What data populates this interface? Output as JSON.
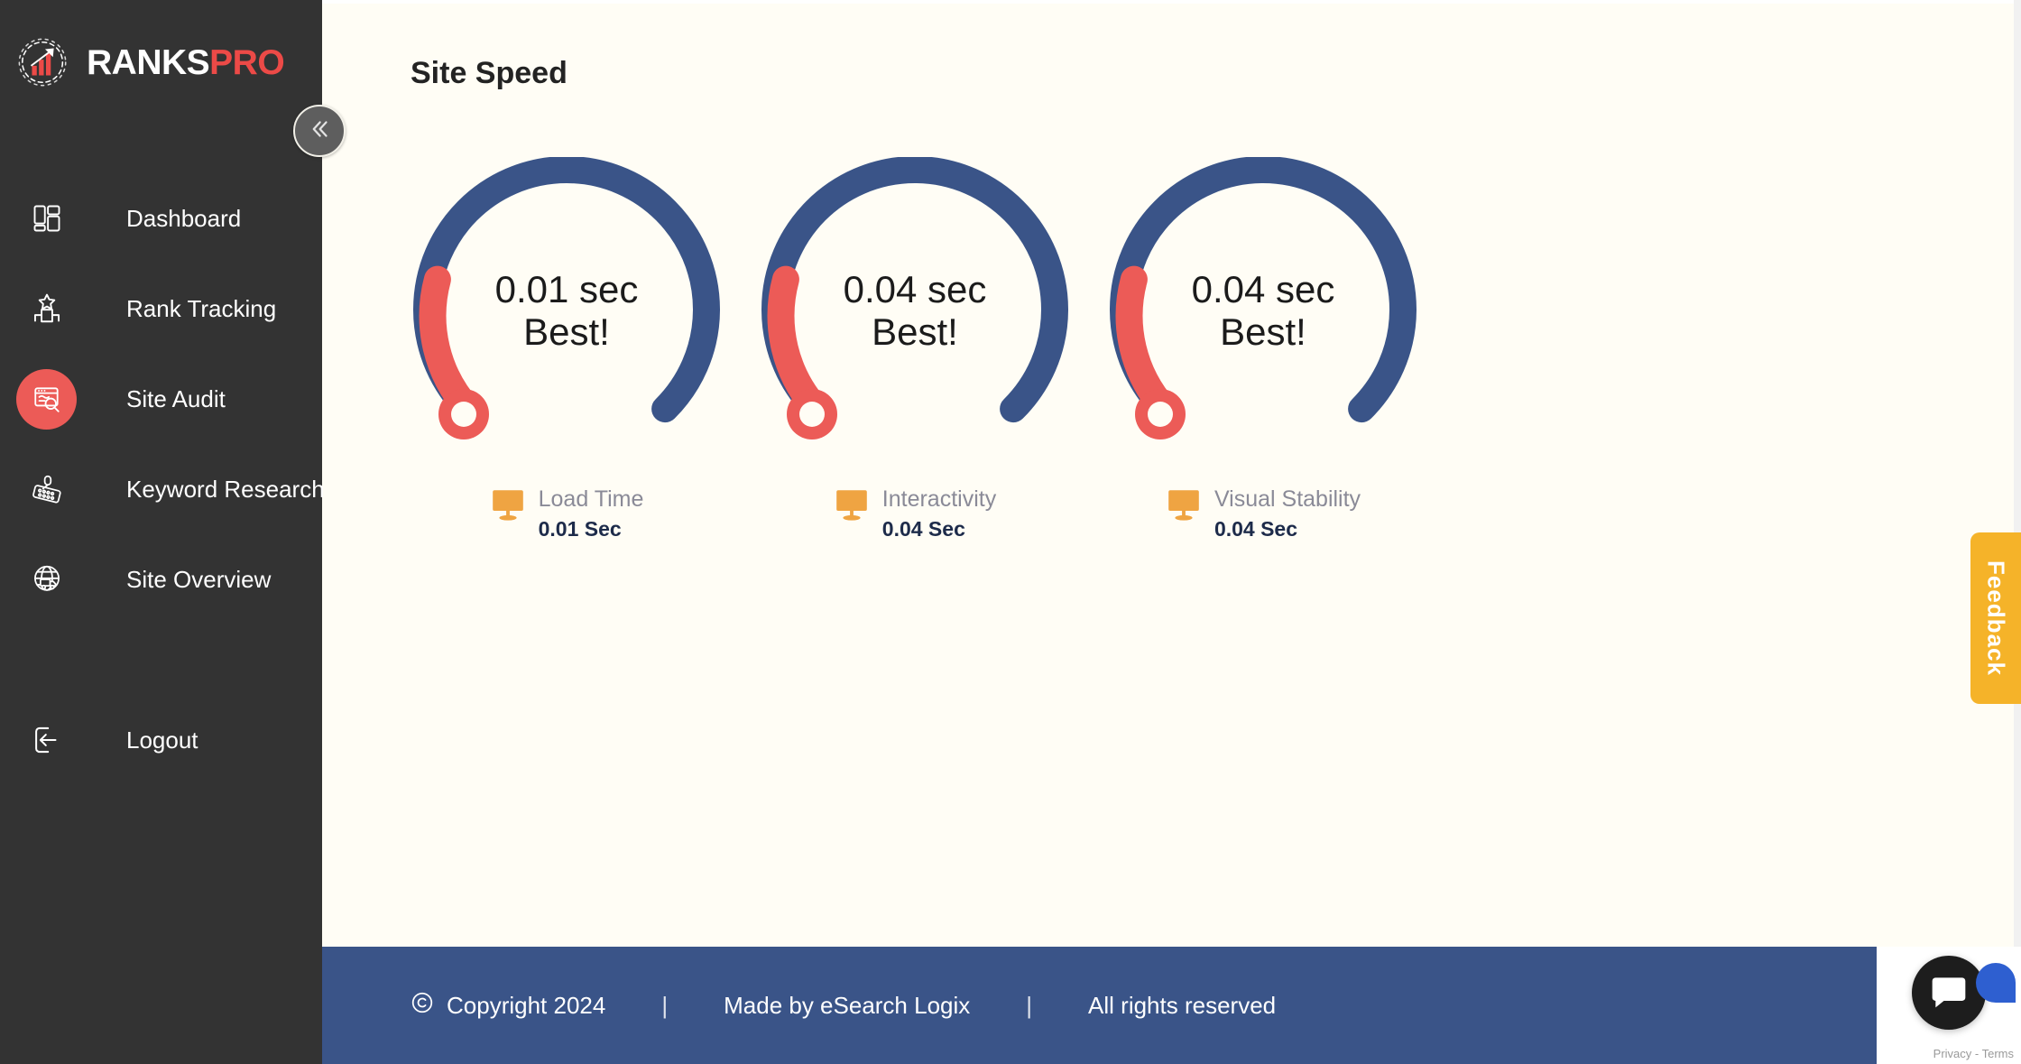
{
  "brand": {
    "name_primary": "RANKS",
    "name_secondary": "PRO",
    "logo_icon": "gear-bar-chart-arrow-icon"
  },
  "sidebar": {
    "collapse_icon": "chevron-double-left-icon",
    "items": [
      {
        "label": "Dashboard",
        "icon": "dashboard-grid-icon",
        "active": false
      },
      {
        "label": "Rank Tracking",
        "icon": "podium-star-icon",
        "active": false
      },
      {
        "label": "Site Audit",
        "icon": "browser-search-icon",
        "active": true
      },
      {
        "label": "Keyword Research",
        "icon": "keyboard-mouse-icon",
        "active": false
      },
      {
        "label": "Site Overview",
        "icon": "globe-truck-icon",
        "active": false
      },
      {
        "label": "Logout",
        "icon": "logout-arrow-icon",
        "active": false
      }
    ],
    "active_bg_color": "#ec5b57",
    "bg_color": "#333333"
  },
  "main": {
    "page_title": "Site Speed",
    "bg_color": "#fffdf5"
  },
  "chart_data": {
    "type": "gauge",
    "title": "Site Speed",
    "gauge_track_color": "#3a5488",
    "gauge_progress_color": "#ec5b57",
    "gauge_knob_color": "#ec5b57",
    "gauge_max_sweep_degrees": 270,
    "unit": "sec",
    "gauges": [
      {
        "metric": "Load Time",
        "value": 0.01,
        "value_text": "0.01 sec",
        "status_text": "Best!",
        "metric_value_text": "0.01 Sec",
        "metric_icon": "monitor-icon",
        "progress_fraction": 0.33
      },
      {
        "metric": "Interactivity",
        "value": 0.04,
        "value_text": "0.04 sec",
        "status_text": "Best!",
        "metric_value_text": "0.04 Sec",
        "metric_icon": "monitor-icon",
        "progress_fraction": 0.33
      },
      {
        "metric": "Visual Stability",
        "value": 0.04,
        "value_text": "0.04 sec",
        "status_text": "Best!",
        "metric_value_text": "0.04 Sec",
        "metric_icon": "monitor-icon",
        "progress_fraction": 0.33
      }
    ]
  },
  "footer": {
    "copyright_icon": "copyright-icon",
    "copyright": "Copyright 2024",
    "divider": "|",
    "made_by": "Made by eSearch Logix",
    "rights": "All rights reserved",
    "bg_color": "#3a5488"
  },
  "overlays": {
    "feedback_label": "Feedback",
    "feedback_color": "#f5b329",
    "chat_icon": "chat-bubble-icon",
    "recaptcha_text": "Privacy - Terms"
  }
}
